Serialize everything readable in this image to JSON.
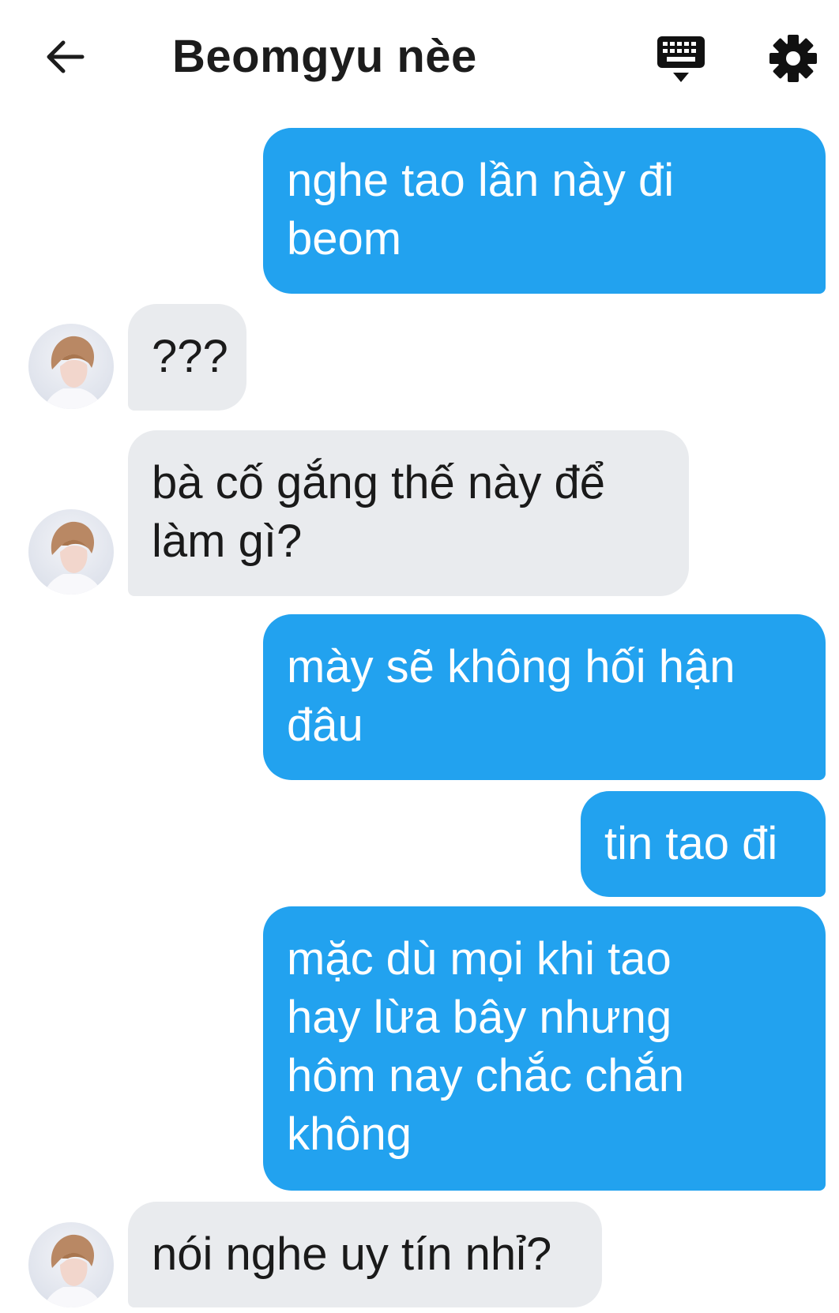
{
  "header": {
    "title": "Beomgyu nèe",
    "back_icon": "arrow-left-icon",
    "keyboard_icon": "keyboard-icon",
    "settings_icon": "gear-icon"
  },
  "colors": {
    "sent_bubble": "#22a2ef",
    "received_bubble": "#e9ebee",
    "sent_text": "#ffffff",
    "received_text": "#1a1a1a"
  },
  "messages": [
    {
      "sender": "me",
      "text": "nghe tao lần này đi\nbeom"
    },
    {
      "sender": "them",
      "text": "???"
    },
    {
      "sender": "them",
      "text": "bà cố gắng thế này để\nlàm gì?"
    },
    {
      "sender": "me",
      "text": "mày sẽ không hối hận\nđâu"
    },
    {
      "sender": "me",
      "text": "tin tao đi"
    },
    {
      "sender": "me",
      "text": "mặc dù mọi khi tao\nhay lừa bây nhưng\nhôm nay chắc chắn\nkhông"
    },
    {
      "sender": "them",
      "text": "nói nghe uy tín nhỉ?"
    }
  ]
}
